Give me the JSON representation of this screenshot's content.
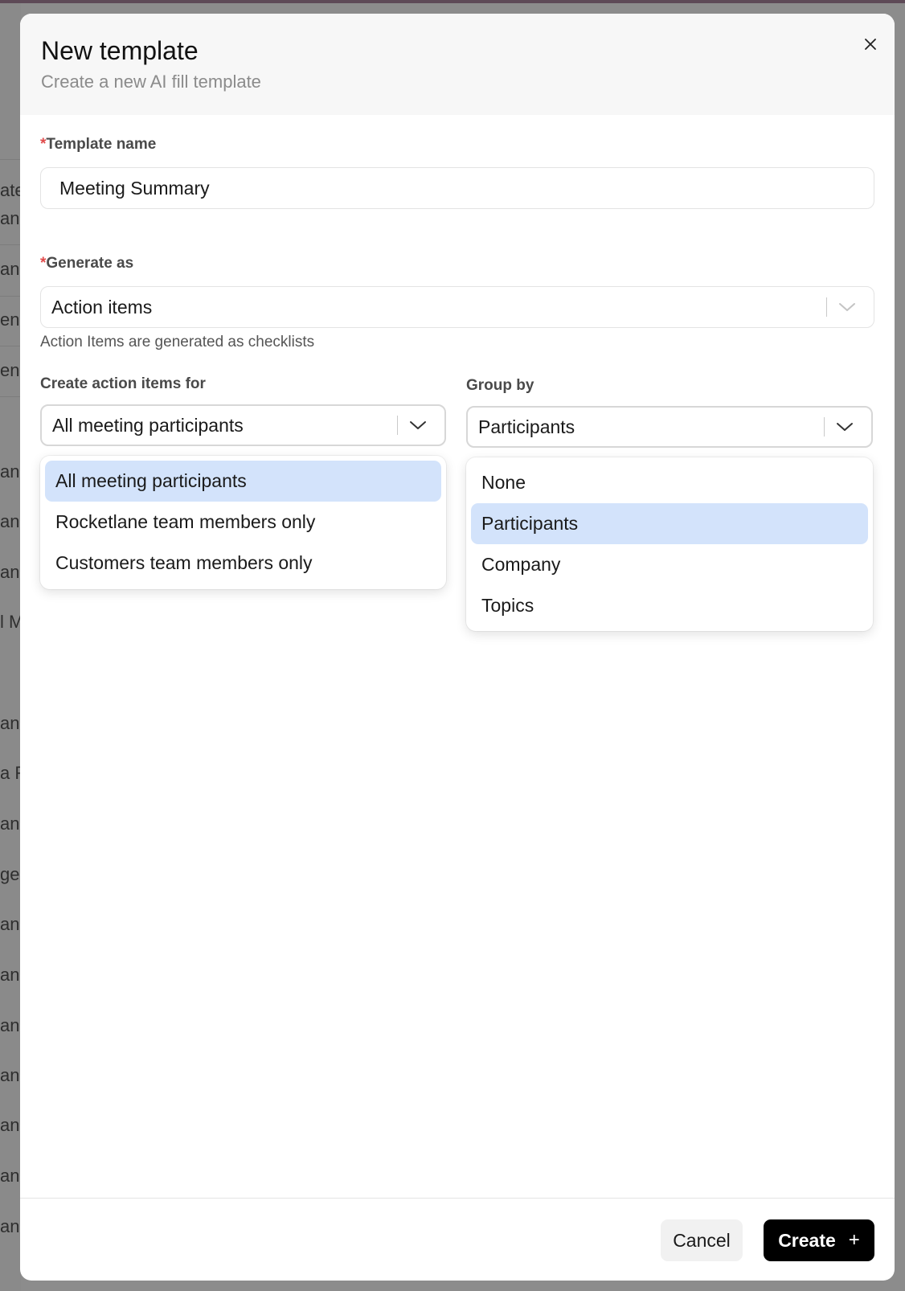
{
  "background": {
    "snippets": [
      "ate",
      "an",
      "an",
      "enu",
      "enu",
      "an",
      "an",
      "an",
      "l M",
      "an",
      "a R",
      "an",
      "gel",
      "an",
      "an",
      "an",
      "an",
      "an",
      "an",
      "an"
    ]
  },
  "modal": {
    "title": "New template",
    "subtitle": "Create a new AI fill template",
    "close_icon": "close-icon"
  },
  "form": {
    "required_marker": "*",
    "template_name": {
      "label": "Template name",
      "value": "Meeting Summary"
    },
    "generate_as": {
      "label": "Generate as",
      "value": "Action items",
      "helper": "Action Items are generated as checklists"
    },
    "create_for": {
      "label": "Create action items for",
      "value": "All meeting participants",
      "options": [
        {
          "label": "All meeting participants",
          "selected": true
        },
        {
          "label": "Rocketlane team members only",
          "selected": false
        },
        {
          "label": "Customers team members only",
          "selected": false
        }
      ]
    },
    "group_by": {
      "label": "Group by",
      "value": "Participants",
      "options": [
        {
          "label": "None",
          "selected": false
        },
        {
          "label": "Participants",
          "selected": true
        },
        {
          "label": "Company",
          "selected": false
        },
        {
          "label": "Topics",
          "selected": false
        }
      ]
    }
  },
  "footer": {
    "cancel_label": "Cancel",
    "create_label": "Create",
    "create_icon": "+"
  },
  "colors": {
    "accent_selected": "#d3e3fb",
    "required": "#e04a4a",
    "primary_button": "#000000"
  }
}
